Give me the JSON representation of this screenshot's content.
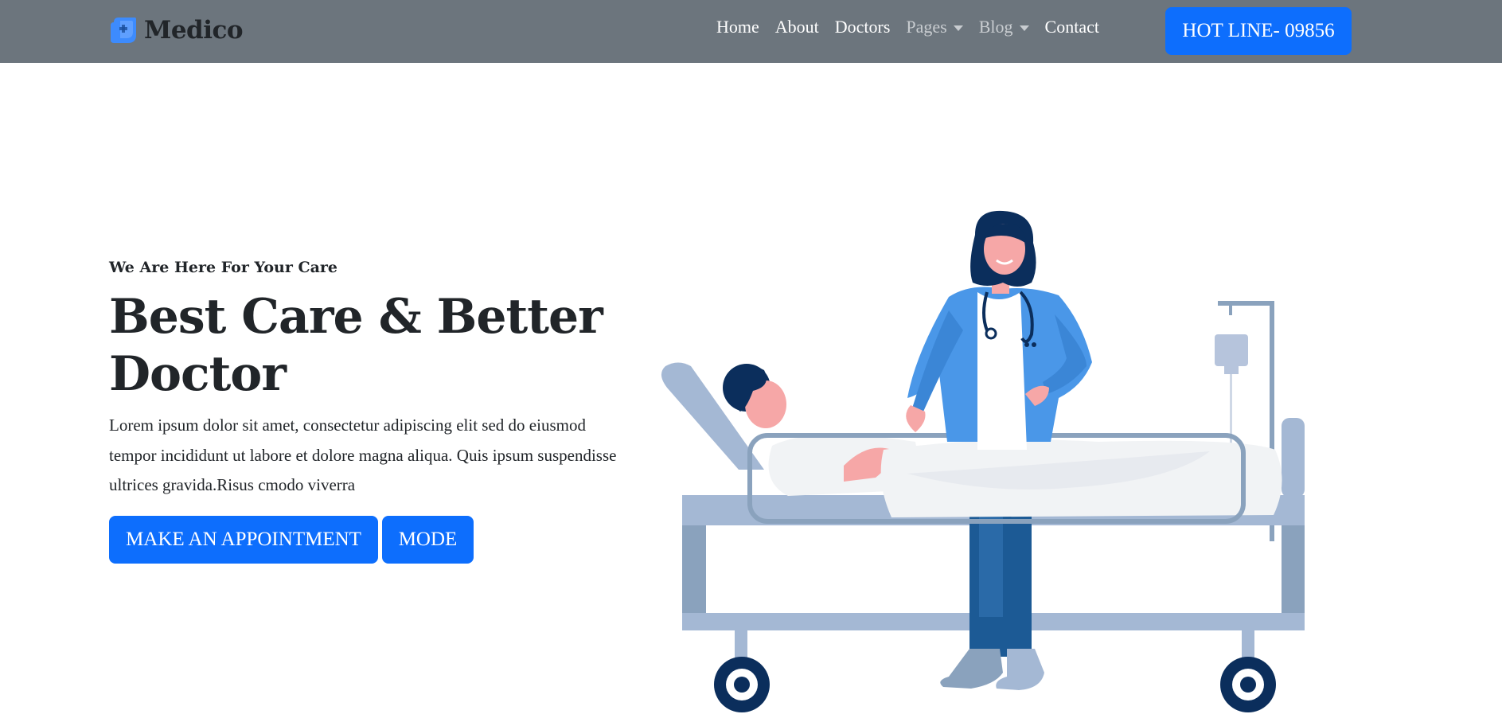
{
  "brand": {
    "name": "Medico",
    "logo_icon": "medical-cross-logo-icon"
  },
  "nav": {
    "items": [
      {
        "label": "Home",
        "dropdown": false,
        "muted": false
      },
      {
        "label": "About",
        "dropdown": false,
        "muted": false
      },
      {
        "label": "Doctors",
        "dropdown": false,
        "muted": false
      },
      {
        "label": "Pages",
        "dropdown": true,
        "muted": true
      },
      {
        "label": "Blog",
        "dropdown": true,
        "muted": true
      },
      {
        "label": "Contact",
        "dropdown": false,
        "muted": false
      }
    ]
  },
  "hotline": {
    "label": "HOT LINE- 09856"
  },
  "hero": {
    "kicker": "We Are Here For Your Care",
    "headline": "Best Care & Better Doctor",
    "description": "Lorem ipsum dolor sit amet, consectetur adipiscing elit sed do eiusmod tempor incididunt ut labore et dolore magna aliqua. Quis ipsum suspendisse ultrices gravida.Risus cmodo viverra",
    "appointment_button": "MAKE AN APPOINTMENT",
    "mode_button": "MODE"
  },
  "colors": {
    "navbar_bg": "#6c757d",
    "primary": "#0d6efd",
    "text": "#212529",
    "bed_light": "#a4b8d4",
    "bed_dark": "#8aa2bd",
    "coat": "#4a97e8",
    "navy": "#0b2e5c"
  }
}
